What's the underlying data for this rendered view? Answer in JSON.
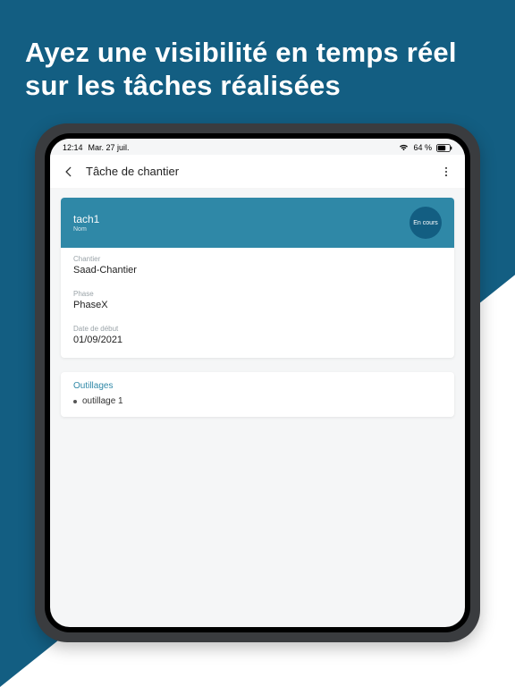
{
  "marketing": {
    "headline": "Ayez une visibilité en temps réel sur les tâches réalisées"
  },
  "statusbar": {
    "time": "12:14",
    "date": "Mar. 27 juil.",
    "battery_pct": "64 %"
  },
  "appbar": {
    "title": "Tâche de chantier"
  },
  "task": {
    "name": "tach1",
    "name_label": "Nom",
    "status_text": "En cours",
    "fields": [
      {
        "label": "Chantier",
        "value": "Saad-Chantier"
      },
      {
        "label": "Phase",
        "value": "PhaseX"
      },
      {
        "label": "Date de début",
        "value": "01/09/2021"
      }
    ]
  },
  "outillages": {
    "section_title": "Outillages",
    "items": [
      "outillage 1"
    ]
  },
  "colors": {
    "brand_bg": "#135E82",
    "accent": "#2F88A7"
  }
}
